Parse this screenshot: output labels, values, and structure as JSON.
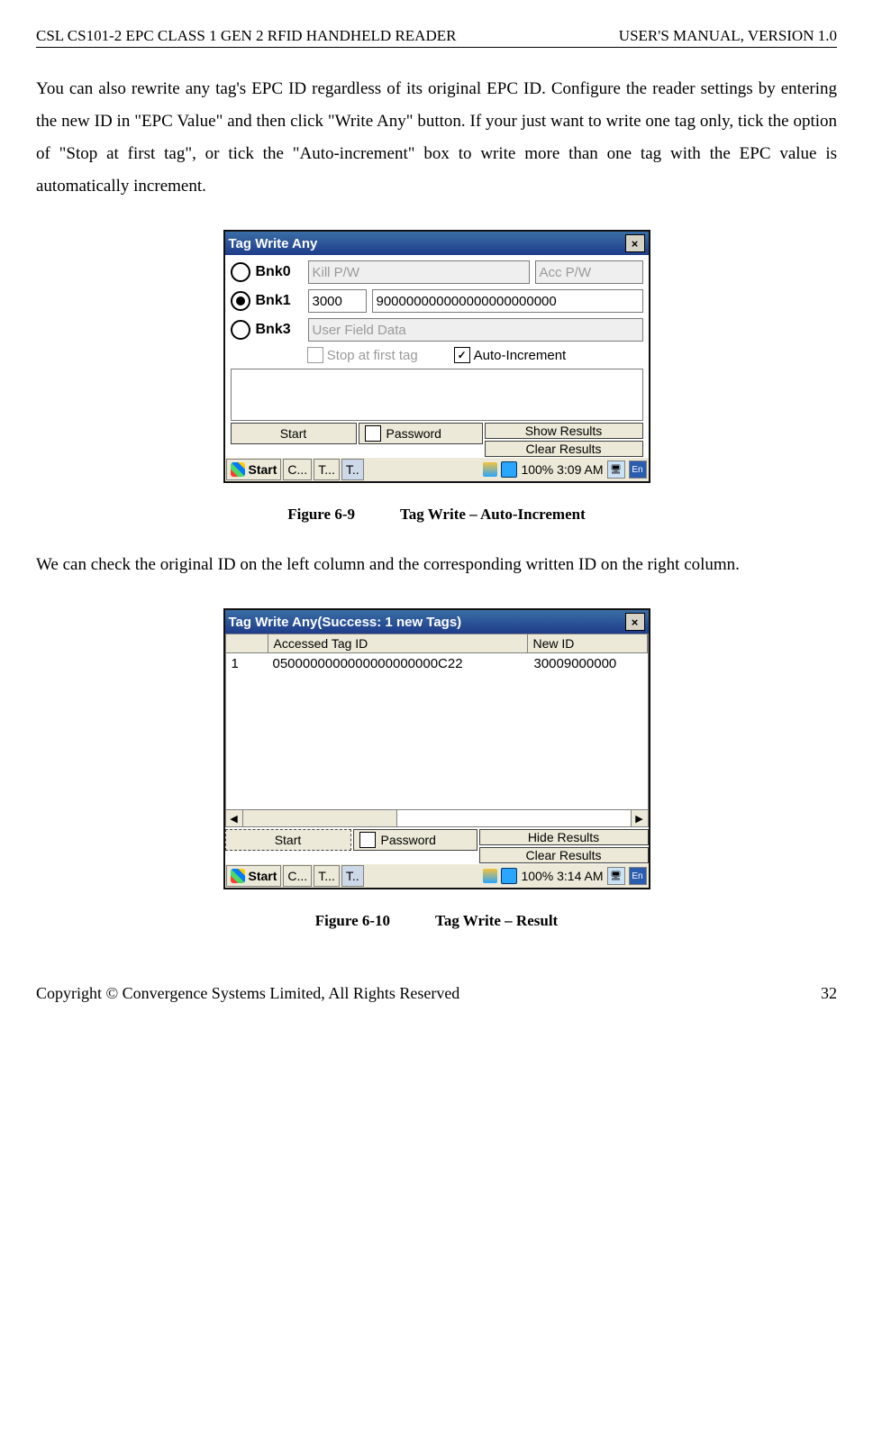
{
  "header": {
    "left": "CSL CS101-2 EPC CLASS 1 GEN 2 RFID HANDHELD READER",
    "right": "USER'S  MANUAL,  VERSION  1.0"
  },
  "para1": "You can also rewrite any tag's EPC ID regardless of its original EPC ID. Configure the reader settings by entering the new ID in \"EPC Value\" and then click \"Write Any\" button. If your just want to write one tag only, tick the option of \"Stop at first tag\", or tick the \"Auto-increment\" box to write more than one tag with the EPC value is automatically increment.",
  "caption1": {
    "fig": "Figure 6-9",
    "txt": "Tag Write – Auto-Increment"
  },
  "para2": "We can check the original ID on the left column and the corresponding written ID on the right column.",
  "caption2": {
    "fig": "Figure 6-10",
    "txt": "Tag Write – Result"
  },
  "footer": {
    "left": "Copyright © Convergence Systems Limited, All Rights Reserved",
    "right": "32"
  },
  "win1": {
    "title": "Tag Write Any",
    "bnk0": "Bnk0",
    "bnk1": "Bnk1",
    "bnk3": "Bnk3",
    "kill": "Kill P/W",
    "acc": "Acc P/W",
    "prefix": "3000",
    "epc": "900000000000000000000000",
    "user": "User Field Data",
    "stop": "Stop at first tag",
    "auto": "Auto-Increment",
    "start": "Start",
    "password": "Password",
    "show": "Show Results",
    "clear": "Clear Results",
    "taskbar": {
      "start": "Start",
      "c": "C...",
      "t1": "T...",
      "t2": "T..",
      "pct": "100% 3:09 AM",
      "en": "En"
    }
  },
  "win2": {
    "title": "Tag Write Any(Success: 1 new Tags)",
    "col1": "Accessed Tag ID",
    "col2": "New ID",
    "row": {
      "n": "1",
      "id": "0500000000000000000000C22",
      "new": "30009000000"
    },
    "start": "Start",
    "password": "Password",
    "hide": "Hide Results",
    "clear": "Clear Results",
    "taskbar": {
      "start": "Start",
      "c": "C...",
      "t1": "T...",
      "t2": "T..",
      "pct": "100% 3:14 AM",
      "en": "En"
    }
  }
}
